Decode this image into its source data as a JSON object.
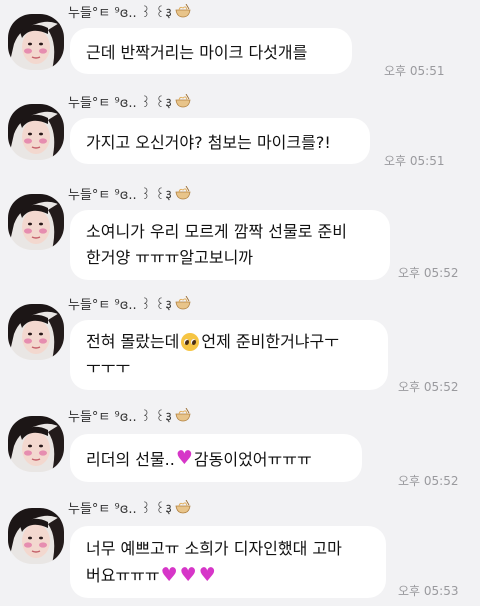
{
  "sender": {
    "name": "누들°ㅌ ⁹ɞ.. ꒱ ꒰३",
    "badge_icon": "noodle-bowl-icon"
  },
  "messages": [
    {
      "lines": [
        {
          "text": "근데 반짝거리는 마이크 다섯개를"
        }
      ],
      "time": "오후 05:51"
    },
    {
      "lines": [
        {
          "text": "가지고 오신거야? 첨보는 마이크를?!"
        }
      ],
      "time": "오후 05:51"
    },
    {
      "lines": [
        {
          "text": "소여니가 우리 모르게 깜짝 선물로 준비"
        },
        {
          "text": "한거양 ㅠㅠㅠ알고보니까"
        }
      ],
      "time": "오후 05:52"
    },
    {
      "lines": [
        {
          "text": "전혀 몰랐는데",
          "emoji": "pleading-face",
          "after": " 언제 준비한거냐구ㅜ"
        },
        {
          "text": "ㅜㅜㅜ"
        }
      ],
      "time": "오후 05:52"
    },
    {
      "lines": [
        {
          "text": "리더의 선물..",
          "emoji": "heart",
          "after": " 감동이었어ㅠㅠㅠ"
        }
      ],
      "time": "오후 05:52"
    },
    {
      "lines": [
        {
          "text": "너무 예쁘고ㅠ 소희가 디자인했대 고마"
        },
        {
          "text": "버요ㅠㅠㅠ",
          "emoji": "heart-x3"
        }
      ],
      "time": "오후 05:53"
    }
  ],
  "colors": {
    "background": "#f2f2f4",
    "bubble": "#ffffff",
    "heart": "#d636c8",
    "timestamp": "#9a9a9e"
  }
}
